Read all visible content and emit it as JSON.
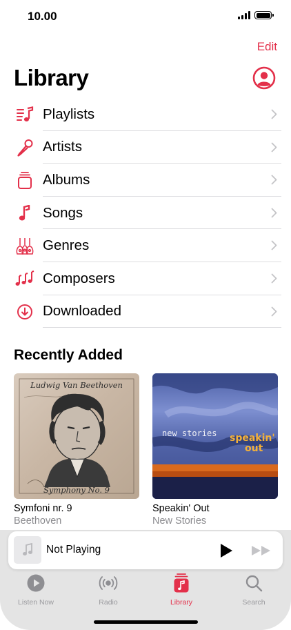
{
  "status_bar": {
    "time": "10.00"
  },
  "header": {
    "edit_label": "Edit",
    "title": "Library",
    "account_icon": "person-circle-icon"
  },
  "menu": {
    "items": [
      {
        "label": "Playlists",
        "icon": "playlist-icon"
      },
      {
        "label": "Artists",
        "icon": "microphone-icon"
      },
      {
        "label": "Albums",
        "icon": "album-stack-icon"
      },
      {
        "label": "Songs",
        "icon": "music-note-icon"
      },
      {
        "label": "Genres",
        "icon": "guitars-icon"
      },
      {
        "label": "Composers",
        "icon": "composer-notes-icon"
      },
      {
        "label": "Downloaded",
        "icon": "download-circle-icon"
      }
    ]
  },
  "recently_added": {
    "title": "Recently Added",
    "albums": [
      {
        "title": "Symfoni nr. 9",
        "artist": "Beethoven",
        "cover_heading": "Ludwig Van Beethoven",
        "cover_footer": "Symphony No. 9"
      },
      {
        "title": "Speakin' Out",
        "artist": "New Stories",
        "cover_band": "new stories",
        "cover_title_line1": "speakin'",
        "cover_title_line2": "out"
      }
    ]
  },
  "mini_player": {
    "title": "Not Playing"
  },
  "tab_bar": {
    "tabs": [
      {
        "label": "Listen Now",
        "icon": "play-circle-icon",
        "active": false
      },
      {
        "label": "Radio",
        "icon": "radio-waves-icon",
        "active": false
      },
      {
        "label": "Library",
        "icon": "library-icon",
        "active": true
      },
      {
        "label": "Search",
        "icon": "search-icon",
        "active": false
      }
    ]
  },
  "colors": {
    "accent": "#e3304a",
    "secondary_text": "#8a8a8e",
    "tab_inactive": "#9a9a9e"
  }
}
